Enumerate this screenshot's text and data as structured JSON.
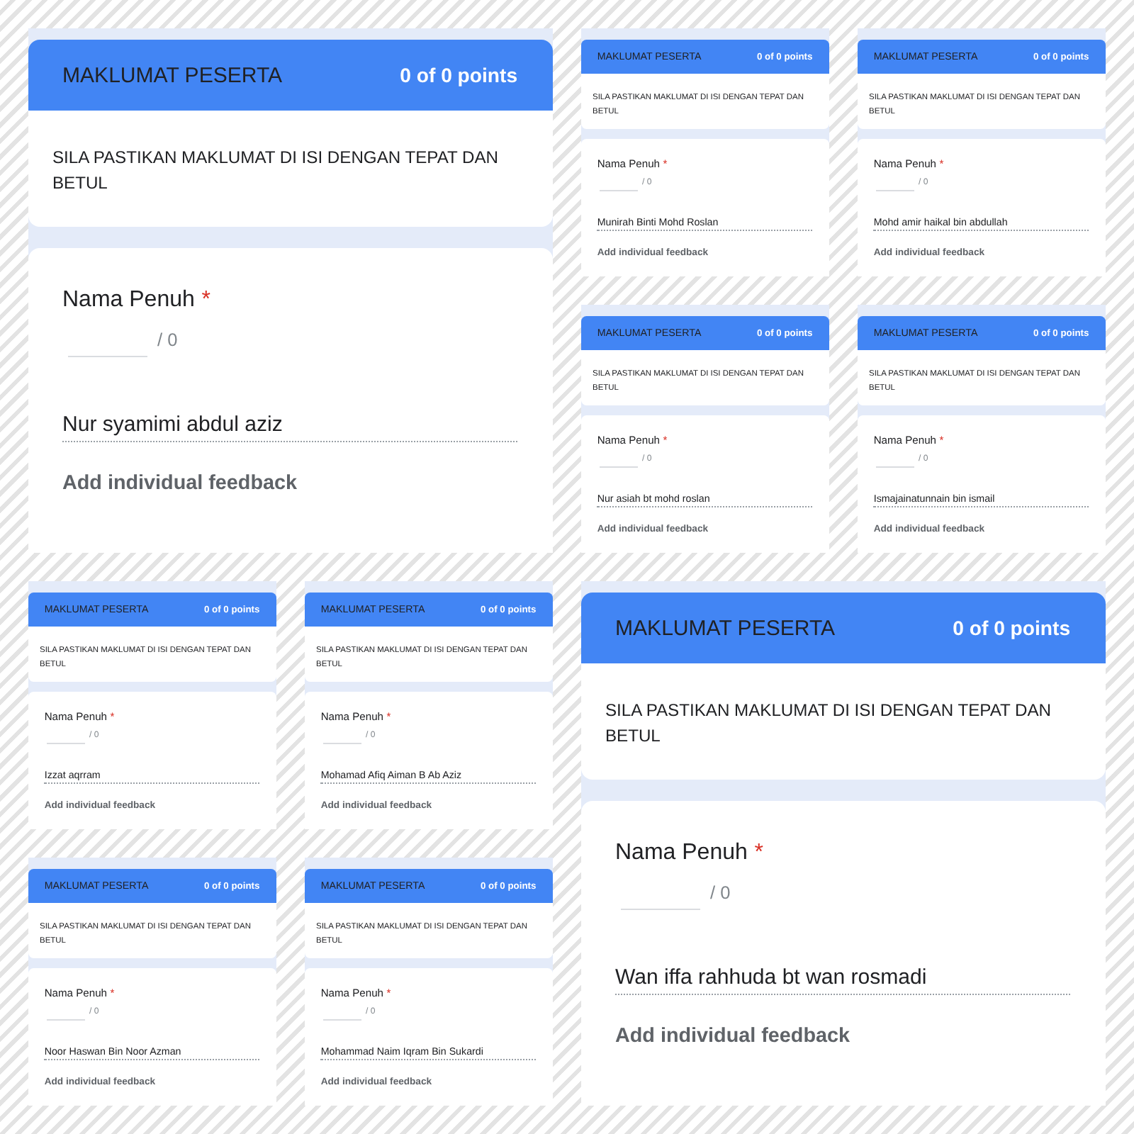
{
  "panels": [
    {
      "kind": "single",
      "responses": [
        {
          "section_title": "MAKLUMAT PESERTA",
          "points": "0 of 0 points",
          "description": "SILA PASTIKAN MAKLUMAT DI ISI DENGAN TEPAT DAN BETUL",
          "question": "Nama Penuh",
          "required_mark": "*",
          "score_max": "/ 0",
          "answer": "Nur syamimi abdul aziz",
          "feedback_link": "Add individual feedback"
        }
      ]
    },
    {
      "kind": "grid",
      "responses": [
        {
          "section_title": "MAKLUMAT PESERTA",
          "points": "0 of 0 points",
          "description": "SILA PASTIKAN MAKLUMAT DI ISI DENGAN TEPAT DAN BETUL",
          "question": "Nama Penuh",
          "required_mark": "*",
          "score_max": "/ 0",
          "answer": "Munirah Binti Mohd Roslan",
          "feedback_link": "Add individual feedback"
        },
        {
          "section_title": "MAKLUMAT PESERTA",
          "points": "0 of 0 points",
          "description": "SILA PASTIKAN MAKLUMAT DI ISI DENGAN TEPAT DAN BETUL",
          "question": "Nama Penuh",
          "required_mark": "*",
          "score_max": "/ 0",
          "answer": "Mohd amir haikal bin abdullah",
          "feedback_link": "Add individual feedback"
        },
        {
          "section_title": "MAKLUMAT PESERTA",
          "points": "0 of 0 points",
          "description": "SILA PASTIKAN MAKLUMAT DI ISI DENGAN TEPAT DAN BETUL",
          "question": "Nama Penuh",
          "required_mark": "*",
          "score_max": "/ 0",
          "answer": "Nur asiah bt mohd roslan",
          "feedback_link": "Add individual feedback"
        },
        {
          "section_title": "MAKLUMAT PESERTA",
          "points": "0 of 0 points",
          "description": "SILA PASTIKAN MAKLUMAT DI ISI DENGAN TEPAT DAN BETUL",
          "question": "Nama Penuh",
          "required_mark": "*",
          "score_max": "/ 0",
          "answer": "Ismajainatunnain bin ismail",
          "feedback_link": "Add individual feedback"
        }
      ]
    },
    {
      "kind": "grid",
      "responses": [
        {
          "section_title": "MAKLUMAT PESERTA",
          "points": "0 of 0 points",
          "description": "SILA PASTIKAN MAKLUMAT DI ISI DENGAN TEPAT DAN BETUL",
          "question": "Nama Penuh",
          "required_mark": "*",
          "score_max": "/ 0",
          "answer": "Izzat aqrram",
          "feedback_link": "Add individual feedback"
        },
        {
          "section_title": "MAKLUMAT PESERTA",
          "points": "0 of 0 points",
          "description": "SILA PASTIKAN MAKLUMAT DI ISI DENGAN TEPAT DAN BETUL",
          "question": "Nama Penuh",
          "required_mark": "*",
          "score_max": "/ 0",
          "answer": "Mohamad Afiq Aiman B Ab Aziz",
          "feedback_link": "Add individual feedback"
        },
        {
          "section_title": "MAKLUMAT PESERTA",
          "points": "0 of 0 points",
          "description": "SILA PASTIKAN MAKLUMAT DI ISI DENGAN TEPAT DAN BETUL",
          "question": "Nama Penuh",
          "required_mark": "*",
          "score_max": "/ 0",
          "answer": "Noor Haswan Bin Noor Azman",
          "feedback_link": "Add individual feedback"
        },
        {
          "section_title": "MAKLUMAT PESERTA",
          "points": "0 of 0 points",
          "description": "SILA PASTIKAN MAKLUMAT DI ISI DENGAN TEPAT DAN BETUL",
          "question": "Nama Penuh",
          "required_mark": "*",
          "score_max": "/ 0",
          "answer": "Mohammad Naim Iqram Bin Sukardi",
          "feedback_link": "Add individual feedback"
        }
      ]
    },
    {
      "kind": "single",
      "responses": [
        {
          "section_title": "MAKLUMAT PESERTA",
          "points": "0 of 0 points",
          "description": "SILA PASTIKAN MAKLUMAT DI ISI DENGAN TEPAT DAN BETUL",
          "question": "Nama Penuh",
          "required_mark": "*",
          "score_max": "/ 0",
          "answer": "Wan iffa rahhuda bt wan rosmadi",
          "feedback_link": "Add individual feedback"
        }
      ]
    }
  ]
}
